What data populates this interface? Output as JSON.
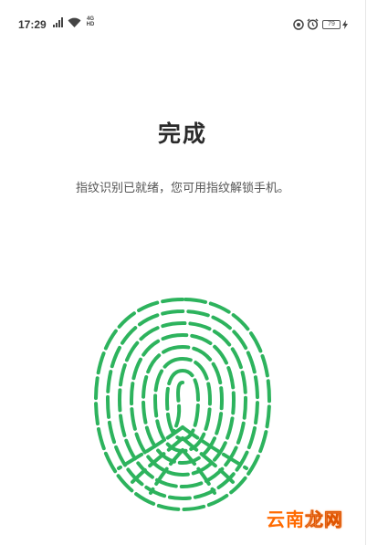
{
  "status_bar": {
    "time": "17:29",
    "network_label_top": "4G",
    "network_label_bottom": "HD",
    "battery_level": "79",
    "icons": [
      "signal-icon",
      "wifi-icon",
      "location-icon",
      "alarm-icon",
      "battery-icon",
      "charging-icon"
    ]
  },
  "screen": {
    "title": "完成",
    "message": "指纹识别已就绪，您可用指纹解锁手机。"
  },
  "fingerprint": {
    "icon": "fingerprint-icon",
    "color": "#2db35d"
  },
  "watermark": {
    "part1": "云南",
    "part2": "龙网"
  }
}
